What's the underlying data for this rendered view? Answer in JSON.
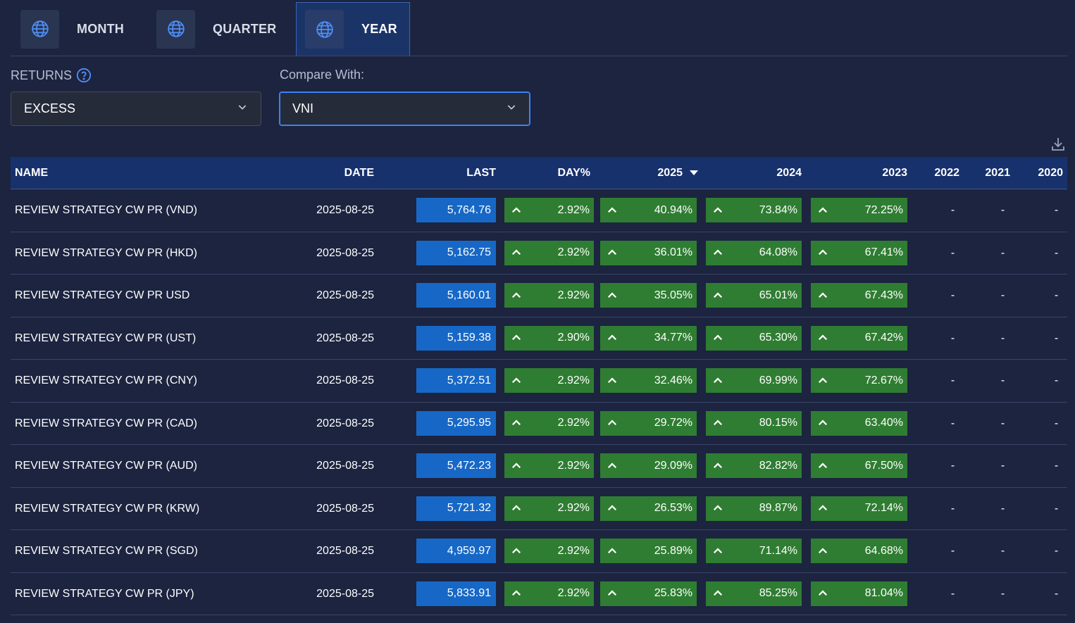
{
  "tabs": [
    {
      "label": "MONTH",
      "active": false
    },
    {
      "label": "QUARTER",
      "active": false
    },
    {
      "label": "YEAR",
      "active": true
    }
  ],
  "filters": {
    "returns_label": "RETURNS",
    "returns_value": "EXCESS",
    "compare_label": "Compare With:",
    "compare_value": "VNI"
  },
  "table": {
    "headers": {
      "name": "NAME",
      "date": "DATE",
      "last": "LAST",
      "day": "DAY%",
      "y2025": "2025",
      "y2024": "2024",
      "y2023": "2023",
      "y2022": "2022",
      "y2021": "2021",
      "y2020": "2020"
    },
    "rows": [
      {
        "name": "REVIEW STRATEGY CW PR (VND)",
        "date": "2025-08-25",
        "last": "5,764.76",
        "day": "2.92%",
        "y2025": "40.94%",
        "y2024": "73.84%",
        "y2023": "72.25%",
        "y2022": "-",
        "y2021": "-",
        "y2020": "-"
      },
      {
        "name": "REVIEW STRATEGY CW PR (HKD)",
        "date": "2025-08-25",
        "last": "5,162.75",
        "day": "2.92%",
        "y2025": "36.01%",
        "y2024": "64.08%",
        "y2023": "67.41%",
        "y2022": "-",
        "y2021": "-",
        "y2020": "-"
      },
      {
        "name": "REVIEW STRATEGY CW PR USD",
        "date": "2025-08-25",
        "last": "5,160.01",
        "day": "2.92%",
        "y2025": "35.05%",
        "y2024": "65.01%",
        "y2023": "67.43%",
        "y2022": "-",
        "y2021": "-",
        "y2020": "-"
      },
      {
        "name": "REVIEW STRATEGY CW PR (UST)",
        "date": "2025-08-25",
        "last": "5,159.38",
        "day": "2.90%",
        "y2025": "34.77%",
        "y2024": "65.30%",
        "y2023": "67.42%",
        "y2022": "-",
        "y2021": "-",
        "y2020": "-"
      },
      {
        "name": "REVIEW STRATEGY CW PR (CNY)",
        "date": "2025-08-25",
        "last": "5,372.51",
        "day": "2.92%",
        "y2025": "32.46%",
        "y2024": "69.99%",
        "y2023": "72.67%",
        "y2022": "-",
        "y2021": "-",
        "y2020": "-"
      },
      {
        "name": "REVIEW STRATEGY CW PR (CAD)",
        "date": "2025-08-25",
        "last": "5,295.95",
        "day": "2.92%",
        "y2025": "29.72%",
        "y2024": "80.15%",
        "y2023": "63.40%",
        "y2022": "-",
        "y2021": "-",
        "y2020": "-"
      },
      {
        "name": "REVIEW STRATEGY CW PR (AUD)",
        "date": "2025-08-25",
        "last": "5,472.23",
        "day": "2.92%",
        "y2025": "29.09%",
        "y2024": "82.82%",
        "y2023": "67.50%",
        "y2022": "-",
        "y2021": "-",
        "y2020": "-"
      },
      {
        "name": "REVIEW STRATEGY CW PR (KRW)",
        "date": "2025-08-25",
        "last": "5,721.32",
        "day": "2.92%",
        "y2025": "26.53%",
        "y2024": "89.87%",
        "y2023": "72.14%",
        "y2022": "-",
        "y2021": "-",
        "y2020": "-"
      },
      {
        "name": "REVIEW STRATEGY CW PR (SGD)",
        "date": "2025-08-25",
        "last": "4,959.97",
        "day": "2.92%",
        "y2025": "25.89%",
        "y2024": "71.14%",
        "y2023": "64.68%",
        "y2022": "-",
        "y2021": "-",
        "y2020": "-"
      },
      {
        "name": "REVIEW STRATEGY CW PR (JPY)",
        "date": "2025-08-25",
        "last": "5,833.91",
        "day": "2.92%",
        "y2025": "25.83%",
        "y2024": "85.25%",
        "y2023": "81.04%",
        "y2022": "-",
        "y2021": "-",
        "y2020": "-"
      }
    ]
  },
  "icons": {
    "tab_icon": "globe-icon",
    "help": "question-circle-icon",
    "dropdown": "chevron-down-icon",
    "download": "download-icon",
    "trend": "caret-up-icon",
    "sort": "sort-desc-icon"
  },
  "colors": {
    "background": "#1c2440",
    "header": "#17316c",
    "last_box": "#1768c6",
    "positive": "#2f7d32",
    "accent": "#3b82f6"
  }
}
